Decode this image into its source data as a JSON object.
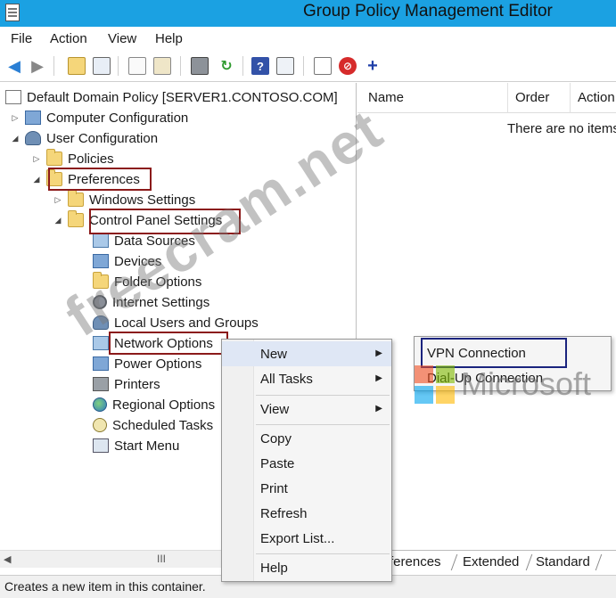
{
  "window": {
    "title": "Group Policy Management Editor"
  },
  "menu": {
    "file": "File",
    "action": "Action",
    "view": "View",
    "help": "Help"
  },
  "toolbar": {
    "buttons": [
      "back-icon",
      "forward-icon",
      "up-folder-icon",
      "show-hide-tree-icon",
      "copy-icon",
      "paste-icon",
      "print-icon",
      "refresh-icon",
      "help-icon",
      "properties-icon",
      "new-item-icon",
      "delete-icon",
      "add-icon"
    ],
    "add_glyph": "+",
    "help_glyph": "?"
  },
  "tree": {
    "root": "Default Domain Policy [SERVER1.CONTOSO.COM]",
    "computer_configuration": "Computer Configuration",
    "user_configuration": "User Configuration",
    "policies": "Policies",
    "preferences": "Preferences",
    "windows_settings": "Windows Settings",
    "control_panel_settings": "Control Panel Settings",
    "items": [
      "Data Sources",
      "Devices",
      "Folder Options",
      "Internet Settings",
      "Local Users and Groups",
      "Network Options",
      "Power Options",
      "Printers",
      "Regional Options",
      "Scheduled Tasks",
      "Start Menu"
    ]
  },
  "list": {
    "columns": [
      "Name",
      "Order",
      "Action"
    ],
    "empty_message": "There are no items"
  },
  "tabs": [
    "Preferences",
    "Extended",
    "Standard"
  ],
  "tab_labels": {
    "first_visible": "ferences"
  },
  "scrollbar": {
    "left_arrow": "◀",
    "grip": "III"
  },
  "status": "Creates a new item in this container.",
  "context_menu": {
    "items": [
      "New",
      "All Tasks",
      "View",
      "Copy",
      "Paste",
      "Print",
      "Refresh",
      "Export List...",
      "Help"
    ]
  },
  "submenu": {
    "items": [
      "VPN Connection",
      "Dial-Up Connection"
    ]
  },
  "watermarks": {
    "site": "freecram.net",
    "brand": "Microsoft"
  },
  "colors": {
    "titlebar": "#1ba1e2",
    "highlight_box": "#8b1a1a",
    "submenu_highlight": "#1a237e"
  }
}
